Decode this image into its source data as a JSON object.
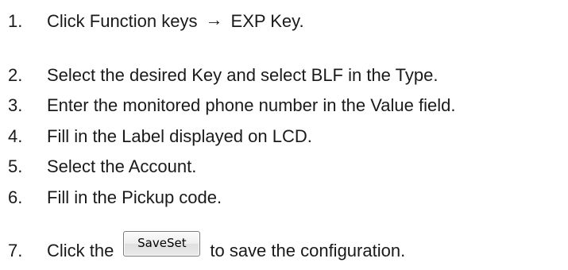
{
  "steps": [
    {
      "num": "1.",
      "text_before": "Click Function keys",
      "arrow": "→",
      "text_after": "EXP Key."
    },
    {
      "num": "2.",
      "text": "Select the desired Key and select BLF in the Type."
    },
    {
      "num": "3.",
      "text": "Enter the monitored phone number in the Value field."
    },
    {
      "num": "4.",
      "text": "Fill in the Label displayed on LCD."
    },
    {
      "num": "5.",
      "text": "Select the Account."
    },
    {
      "num": "6.",
      "text": "Fill in the Pickup code."
    },
    {
      "num": "7.",
      "text_before": "Click the",
      "button_label": "SaveSet",
      "text_after": "to save the configuration."
    }
  ]
}
